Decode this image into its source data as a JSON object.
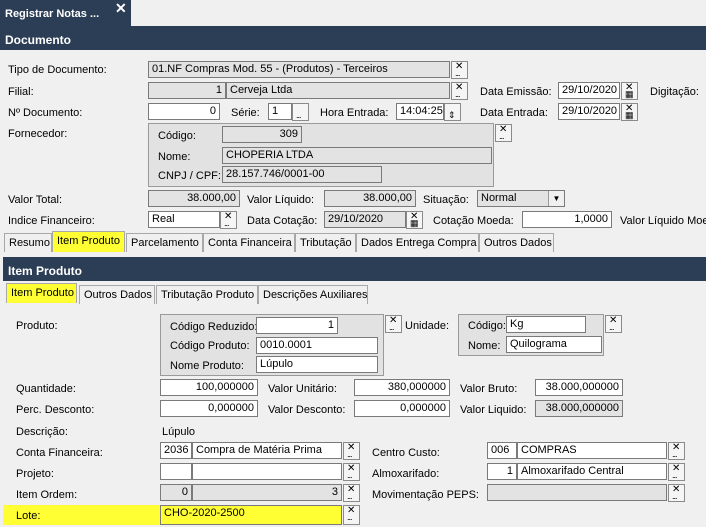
{
  "window_tab": {
    "title": "Registrar Notas ...",
    "close": "✕"
  },
  "section": {
    "documento": "Documento",
    "item_produto": "Item Produto"
  },
  "doc": {
    "tipo_label": "Tipo de Documento:",
    "tipo_value": "01.NF Compras Mod. 55 - (Produtos) - Terceiros",
    "filial_label": "Filial:",
    "filial_code": "1",
    "filial_name": "Cerveja Ltda",
    "data_emissao_label": "Data Emissão:",
    "data_emissao": "29/10/2020",
    "digitacao_label": "Digitação:",
    "ndoc_label": "Nº Documento:",
    "ndoc": "0",
    "serie_label": "Série:",
    "serie": "1",
    "hora_label": "Hora Entrada:",
    "hora": "14:04:25",
    "data_entrada_label": "Data Entrada:",
    "data_entrada": "29/10/2020",
    "fornecedor_label": "Fornecedor:",
    "codigo_label": "Código:",
    "codigo": "309",
    "nome_label": "Nome:",
    "nome": "CHOPERIA LTDA",
    "cnpj_label": "CNPJ / CPF:",
    "cnpj": "28.157.746/0001-00",
    "valor_total_label": "Valor Total:",
    "valor_total": "38.000,00",
    "valor_liquido_label": "Valor Líquido:",
    "valor_liquido": "38.000,00",
    "situacao_label": "Situação:",
    "situacao": "Normal",
    "indice_label": "Indice Financeiro:",
    "indice": "Real",
    "data_cotacao_label": "Data Cotação:",
    "data_cotacao": "29/10/2020",
    "cotacao_moeda_label": "Cotação Moeda:",
    "cotacao_moeda": "1,0000",
    "valor_liq_moe_label": "Valor Líquido Moe"
  },
  "main_tabs": [
    "Resumo",
    "Item Produto",
    "Parcelamento",
    "Conta Financeira",
    "Tributação",
    "Dados Entrega Compra",
    "Outros Dados"
  ],
  "sub_tabs": [
    "Item Produto",
    "Outros Dados",
    "Tributação Produto",
    "Descrições Auxiliares"
  ],
  "item": {
    "produto_label": "Produto:",
    "cod_reduzido_label": "Código Reduzido:",
    "cod_reduzido": "1",
    "cod_produto_label": "Código Produto:",
    "cod_produto": "0010.0001",
    "nome_produto_label": "Nome Produto:",
    "nome_produto": "Lúpulo",
    "unidade_label": "Unidade:",
    "un_codigo_label": "Código:",
    "un_codigo": "Kg",
    "un_nome_label": "Nome:",
    "un_nome": "Quilograma",
    "quantidade_label": "Quantidade:",
    "quantidade": "100,000000",
    "valor_unitario_label": "Valor Unitário:",
    "valor_unitario": "380,000000",
    "valor_bruto_label": "Valor Bruto:",
    "valor_bruto": "38.000,000000",
    "perc_desc_label": "Perc. Desconto:",
    "perc_desc": "0,000000",
    "valor_desc_label": "Valor Desconto:",
    "valor_desc": "0,000000",
    "valor_liquido_label": "Valor Liquido:",
    "valor_liquido": "38.000,000000",
    "descricao_label": "Descrição:",
    "descricao": "Lúpulo",
    "conta_fin_label": "Conta Financeira:",
    "conta_fin_code": "2036",
    "conta_fin_name": "Compra de Matéria Prima",
    "centro_custo_label": "Centro Custo:",
    "centro_custo_code": "006",
    "centro_custo_name": "COMPRAS",
    "projeto_label": "Projeto:",
    "almox_label": "Almoxarifado:",
    "almox_code": "1",
    "almox_name": "Almoxarifado Central",
    "item_ordem_label": "Item Ordem:",
    "item_ordem_a": "0",
    "item_ordem_b": "3",
    "mov_peps_label": "Movimentação PEPS:",
    "lote_label": "Lote:",
    "lote": "CHO-2020-2500"
  },
  "icons": {
    "clear": "✕",
    "dots": "...",
    "calendar": "▦",
    "dropdown": "▼",
    "spin": "⇕"
  }
}
